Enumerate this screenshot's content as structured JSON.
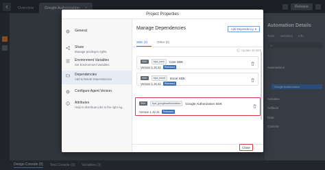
{
  "app": {
    "tabs": [
      {
        "label": "Overview"
      },
      {
        "label": "Google Authorization",
        "active": true
      }
    ],
    "release_label": "Release"
  },
  "right_panel": {
    "title": "Automation Details",
    "tabs": [
      "Tools",
      "Variables",
      "Info"
    ],
    "search_placeholder": "S",
    "sections": [
      "Automations",
      "Activities",
      "Artifacts",
      "Data",
      "Controls"
    ],
    "highlighted_item": "Google Authorization"
  },
  "bottom_bar": {
    "tabs": [
      "Design Console (0)",
      "Test Console (0)",
      "Variables (1)"
    ]
  },
  "dialog": {
    "title": "Project Properties",
    "nav": [
      {
        "title": "General",
        "subtitle": "",
        "icon": "gear-icon"
      },
      {
        "title": "Share",
        "subtitle": "Manage privileges rights",
        "icon": "share-icon"
      },
      {
        "title": "Environment Variables",
        "subtitle": "Set Environment Variables",
        "icon": "list-icon"
      },
      {
        "title": "Dependencies",
        "subtitle": "Add & Delete Dependencies",
        "icon": "folder-icon",
        "active": true
      },
      {
        "title": "Configure Agent Version",
        "subtitle": "",
        "icon": "gear-icon"
      },
      {
        "title": "Attributes",
        "subtitle": "Help to distribute jobs to the right Ag...",
        "icon": "info-icon"
      }
    ],
    "content": {
      "title": "Manage Dependencies",
      "add_button": "Add Dependency",
      "tabs": [
        {
          "label": "SDK (3)",
          "active": true
        },
        {
          "label": "Other (0)"
        }
      ],
      "update_all": "Update all SDK",
      "dependencies": [
        {
          "badge": "SDK",
          "package": "irpa_core",
          "name": "Core SDK",
          "version": "Version 1.32.41",
          "status": "Released",
          "selected": false
        },
        {
          "badge": "SDK",
          "package": "irpa_excel",
          "name": "Excel SDK",
          "version": "Version 1.32.41",
          "status": "Released",
          "selected": false
        },
        {
          "badge": "SDK",
          "package": "irpa_googleauthorization",
          "name": "Google Authorization SDK",
          "version": "Version 1.32.41",
          "status": "Released",
          "selected": true
        }
      ]
    },
    "close_label": "Close"
  }
}
